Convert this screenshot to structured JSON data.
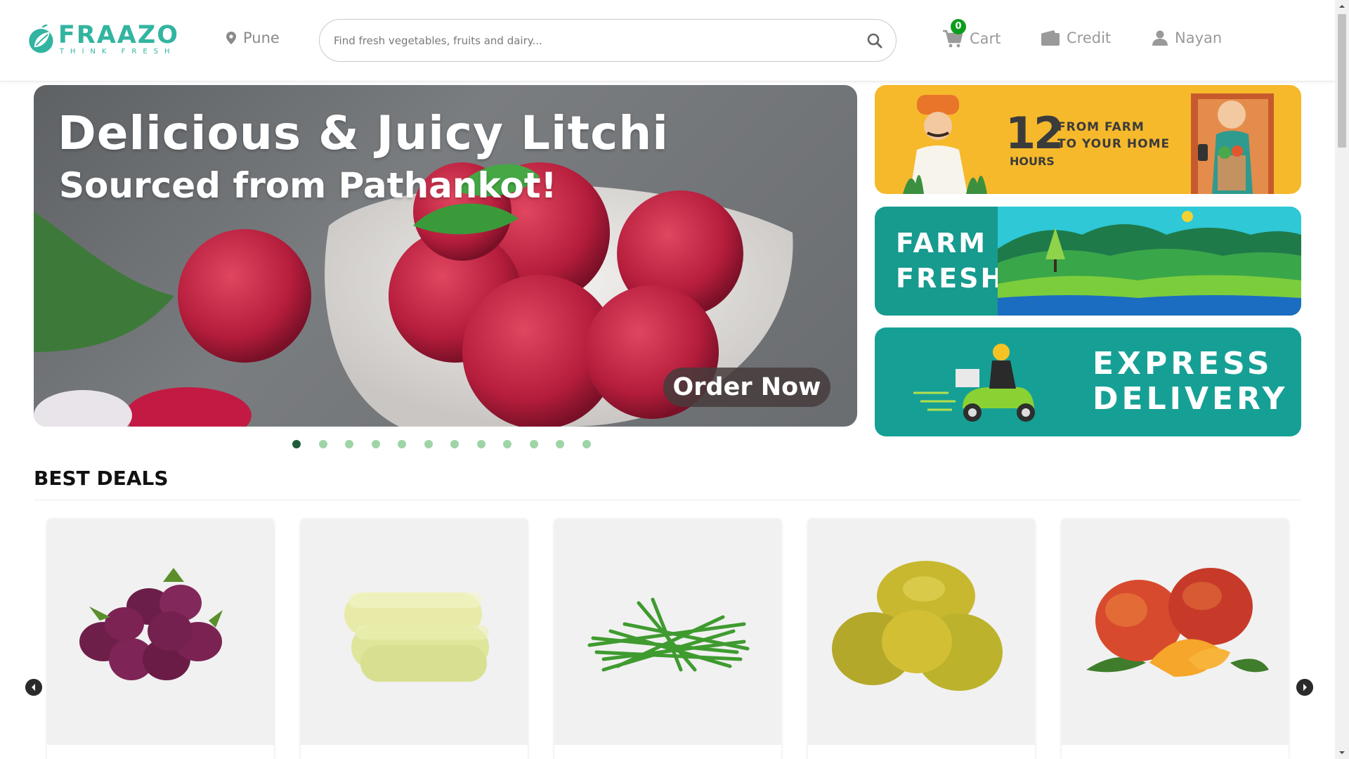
{
  "header": {
    "logo": {
      "name": "FRAAZO",
      "tagline": "THINK FRESH"
    },
    "location": "Pune",
    "search": {
      "placeholder": "Find fresh vegetables, fruits and dairy..."
    },
    "cart": {
      "label": "Cart",
      "count": "0"
    },
    "credit": {
      "label": "Credit"
    },
    "user": {
      "label": "Nayan"
    }
  },
  "hero": {
    "title": "Delicious & Juicy Litchi",
    "subtitle": "Sourced from Pathankot!",
    "cta": "Order Now",
    "slides_total": 12,
    "active_slide": 1
  },
  "side_banners": {
    "hours": {
      "number": "12",
      "unit": "HOURS",
      "line1": "FROM FARM",
      "line2": "TO YOUR HOME"
    },
    "farm": {
      "line1": "FARM",
      "line2": "FRESH"
    },
    "express": {
      "line1": "EXPRESS",
      "line2": "DELIVERY"
    }
  },
  "best_deals": {
    "title": "BEST DEALS",
    "products": [
      {
        "icon": "brinjal-image"
      },
      {
        "icon": "cucumber-image"
      },
      {
        "icon": "cluster-beans-image"
      },
      {
        "icon": "mango-green-image"
      },
      {
        "icon": "mango-red-image"
      }
    ]
  },
  "colors": {
    "brand": "#32b5a0",
    "cart_badge": "#0c9d1d",
    "banner_yellow": "#f6b92c",
    "banner_teal": "#169b8e",
    "dot_active": "#1f5d3a",
    "dot_inactive": "#9fd4a7"
  }
}
